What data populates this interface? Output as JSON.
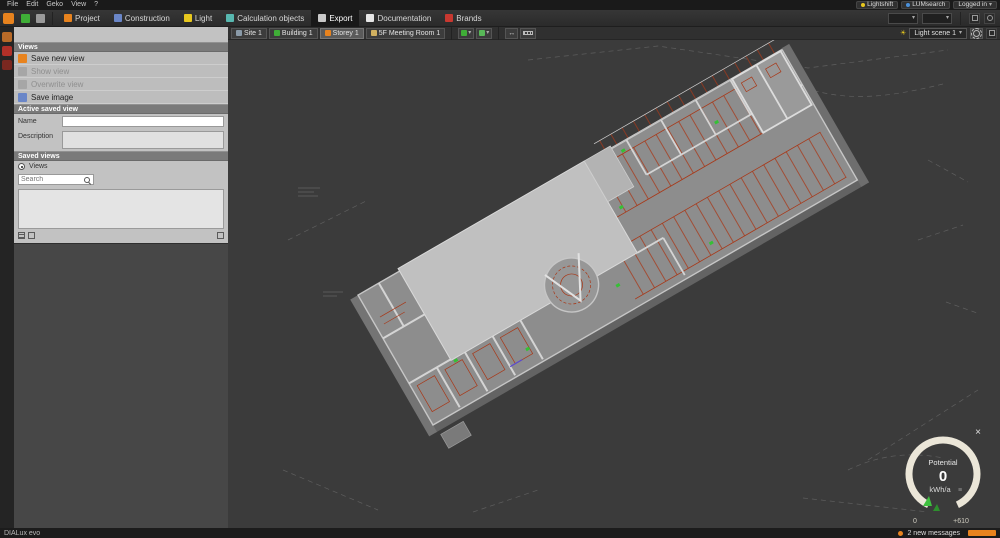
{
  "colors": {
    "accent_orange": "#e8831e",
    "scene_red": "#a83818",
    "scene_green": "#35c035",
    "panel_gray": "#c2c2c2",
    "viewport_gray": "#3b3b3b",
    "gauge_ring": "#ebe6d8"
  },
  "icons": {
    "caret_down": "▾",
    "menu": "≡",
    "close": "×",
    "sun": "☀",
    "fit": "↔"
  },
  "menubar": {
    "items": [
      "File",
      "Edit",
      "Geko",
      "View",
      "?"
    ]
  },
  "titlebar": {
    "lightshift": "Lightshift",
    "lumsearch": "LUMsearch",
    "login": "Logged in"
  },
  "toolbar": {
    "tabs": [
      {
        "label": "Project"
      },
      {
        "label": "Construction"
      },
      {
        "label": "Light"
      },
      {
        "label": "Calculation objects"
      },
      {
        "label": "Export"
      },
      {
        "label": "Documentation"
      },
      {
        "label": "Brands"
      }
    ],
    "active_tab": "Export"
  },
  "viewport_toolbar": {
    "breadcrumbs": [
      {
        "label": "Site 1"
      },
      {
        "label": "Building 1"
      },
      {
        "label": "Storey 1"
      },
      {
        "label": "5F Meeting Room 1"
      }
    ],
    "light_scene": {
      "value": "Light scene 1"
    }
  },
  "sidebar": {
    "panel_title": "Views",
    "actions": [
      {
        "label": "Save new view",
        "enabled": true
      },
      {
        "label": "Show view",
        "enabled": false
      },
      {
        "label": "Overwrite view",
        "enabled": false
      },
      {
        "label": "Save image",
        "enabled": true
      }
    ],
    "active_saved_view": {
      "title": "Active saved view",
      "name_label": "Name",
      "name_value": "",
      "description_label": "Description",
      "description_value": ""
    },
    "saved_views": {
      "title": "Saved views",
      "filter_label": "Views",
      "search_placeholder": "Search"
    }
  },
  "gauge": {
    "title": "Potential",
    "value": "0",
    "unit": "kWh/a",
    "scale_min": "0",
    "scale_max": "+610"
  },
  "statusbar": {
    "app_label": "DIALux evo",
    "messages": "2 new messages"
  }
}
